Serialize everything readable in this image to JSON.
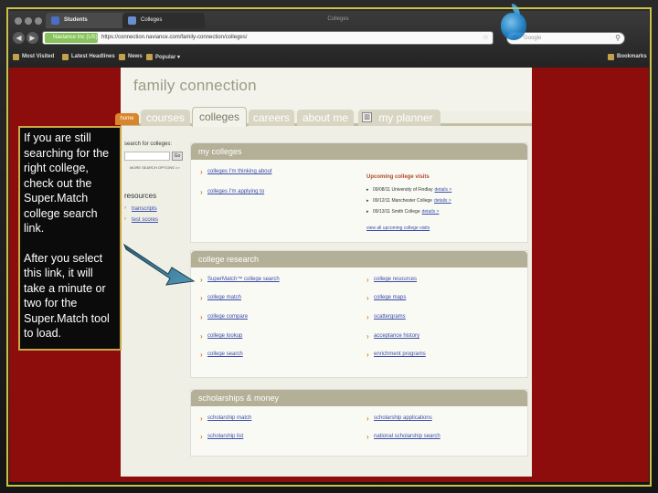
{
  "browser": {
    "window_title": "Colleges",
    "tabs": [
      {
        "label": "Students"
      },
      {
        "label": "Colleges"
      }
    ],
    "identity_label": "Naviance Inc (US)",
    "url": "https://connection.naviance.com/family-connection/colleges/",
    "search_placeholder": "Google",
    "search_engine_glyph": "G",
    "bookmarks": [
      {
        "label": "Most Visited"
      },
      {
        "label": "Latest Headlines"
      },
      {
        "label": "News"
      },
      {
        "label": "Popular ▾"
      }
    ],
    "bookmarks_menu": "Bookmarks"
  },
  "site": {
    "title": "family connection",
    "tabs": [
      {
        "label": "home"
      },
      {
        "label": "courses"
      },
      {
        "label": "colleges"
      },
      {
        "label": "careers"
      },
      {
        "label": "about me"
      },
      {
        "label": "my planner"
      }
    ],
    "left": {
      "search_label": "search for colleges:",
      "go_label": "Go",
      "more_options": "MORE SEARCH OPTIONS >>",
      "resources_label": "resources",
      "resources": [
        {
          "label": "transcripts"
        },
        {
          "label": "test scores"
        }
      ]
    },
    "sections": {
      "my_colleges": {
        "title": "my colleges",
        "links": [
          {
            "label": "colleges I'm thinking about"
          },
          {
            "label": "colleges I'm applying to"
          }
        ],
        "upcoming_title": "Upcoming college visits",
        "visits": [
          {
            "text": "09/08/11 University of Findlay",
            "details": "details >"
          },
          {
            "text": "09/12/11 Manchester College",
            "details": "details >"
          },
          {
            "text": "09/13/11 Smith College",
            "details": "details >"
          }
        ],
        "view_all": "view all upcoming college visits"
      },
      "college_research": {
        "title": "college research",
        "left_links": [
          {
            "label": "SuperMatch™ college search"
          },
          {
            "label": "college match"
          },
          {
            "label": "college compare"
          },
          {
            "label": "college lookup"
          },
          {
            "label": "college search"
          }
        ],
        "right_links": [
          {
            "label": "college resources"
          },
          {
            "label": "college maps"
          },
          {
            "label": "scattergrams"
          },
          {
            "label": "acceptance history"
          },
          {
            "label": "enrichment programs"
          }
        ]
      },
      "scholarships": {
        "title": "scholarships & money",
        "left_links": [
          {
            "label": "scholarship match"
          },
          {
            "label": "scholarship list"
          }
        ],
        "right_links": [
          {
            "label": "scholarship applications"
          },
          {
            "label": "national scholarship search"
          }
        ]
      }
    }
  },
  "callout": {
    "paragraph1": "If you are still searching for the right college, check out the Super.Match college search link.",
    "paragraph2": "After you select this link, it will take a minute or two for the Super.Match tool to load."
  },
  "colors": {
    "page_background": "#8d0c0c",
    "frame_border": "#c9c34a",
    "arrow": "#3f7f9a",
    "section_header": "#b3b097",
    "home_tab": "#d9852a",
    "link": "#3a4da8"
  }
}
